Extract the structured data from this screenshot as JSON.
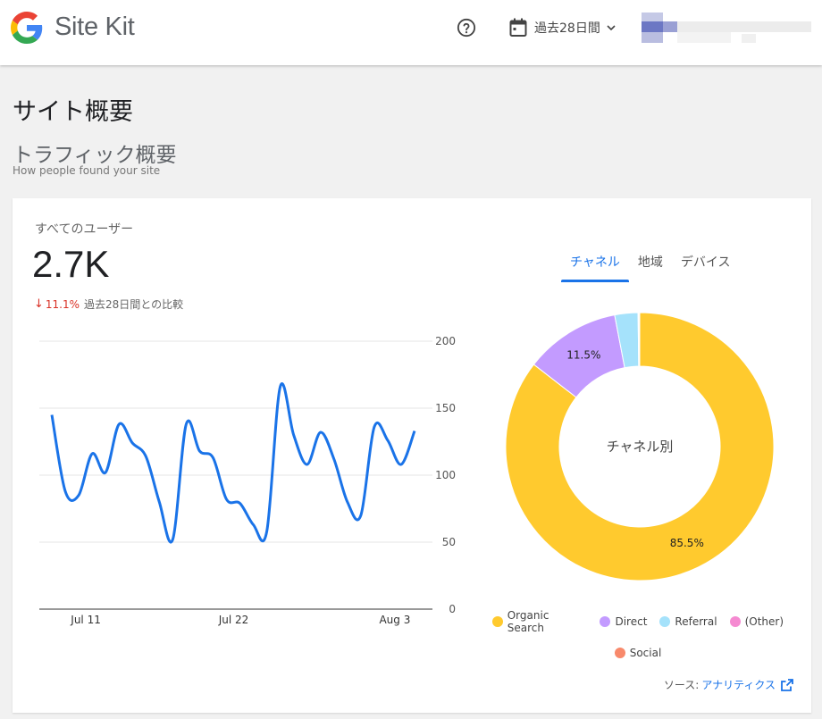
{
  "header": {
    "brand": "Site Kit",
    "date_range_label": "過去28日間"
  },
  "page": {
    "title": "サイト概要",
    "section_title": "トラフィック概要",
    "section_subtitle": "How people found your site"
  },
  "card": {
    "users_label": "すべてのユーザー",
    "users_value": "2.7K",
    "change_pct": "11.1%",
    "change_text": "過去28日間との比較",
    "tabs": [
      {
        "label": "チャネル",
        "active": true
      },
      {
        "label": "地域",
        "active": false
      },
      {
        "label": "デバイス",
        "active": false
      }
    ],
    "source_label": "ソース:",
    "source_link": "アナリティクス",
    "donut_center_label": "チャネル別"
  },
  "colors": {
    "line": "#1a73e8",
    "organic": "#ffca2e",
    "direct": "#c39bff",
    "referral": "#a5e2fb",
    "other": "#f58ad1",
    "social": "#f8896b",
    "decline": "#d93025"
  },
  "chart_data": [
    {
      "type": "line",
      "ylim": [
        0,
        200
      ],
      "yticks": [
        "200",
        "150",
        "100",
        "50",
        "0"
      ],
      "xticks": [
        {
          "label": "Jul 11",
          "index": 2
        },
        {
          "label": "Jul 22",
          "index": 13
        },
        {
          "label": "Aug 3",
          "index": 25
        }
      ],
      "values": [
        145,
        88,
        85,
        116,
        102,
        138,
        124,
        114,
        80,
        52,
        138,
        118,
        113,
        82,
        79,
        63,
        58,
        166,
        130,
        108,
        132,
        112,
        80,
        70,
        136,
        126,
        108,
        133
      ]
    },
    {
      "type": "pie",
      "center_label": "チャネル別",
      "slices": [
        {
          "label": "Organic Search",
          "value": 85.5,
          "color": "#ffca2e",
          "show_label": true
        },
        {
          "label": "Direct",
          "value": 11.5,
          "color": "#c39bff",
          "show_label": true
        },
        {
          "label": "Referral",
          "value": 2.8,
          "color": "#a5e2fb",
          "show_label": false
        },
        {
          "label": "(Other)",
          "value": 0.1,
          "color": "#f58ad1",
          "show_label": false
        },
        {
          "label": "Social",
          "value": 0.1,
          "color": "#f8896b",
          "show_label": false
        }
      ]
    }
  ]
}
